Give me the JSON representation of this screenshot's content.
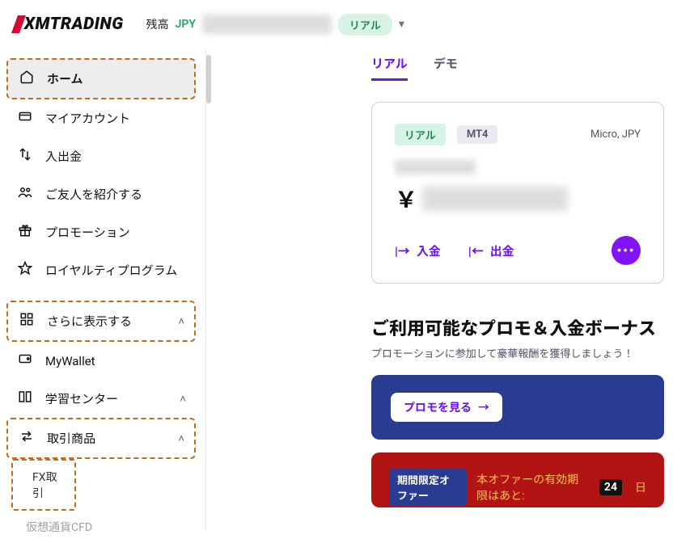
{
  "header": {
    "brand": "XMTRADING",
    "balance_label": "残高",
    "balance_currency": "JPY",
    "account_type": "リアル"
  },
  "sidebar": {
    "items": [
      {
        "icon": "home-icon",
        "glyph": "⌂",
        "label": "ホーム",
        "highlight": true,
        "active": true
      },
      {
        "icon": "account-icon",
        "glyph": "⧉",
        "label": "マイアカウント"
      },
      {
        "icon": "transfer-icon",
        "glyph": "↑↓",
        "label": "入出金"
      },
      {
        "icon": "referral-icon",
        "glyph": "👥",
        "label": "ご友人を紹介する"
      },
      {
        "icon": "gift-icon",
        "glyph": "🎁",
        "label": "プロモーション"
      },
      {
        "icon": "star-icon",
        "glyph": "☆",
        "label": "ロイヤルティプログラム"
      }
    ],
    "more_group": [
      {
        "icon": "grid-icon",
        "glyph": "▦",
        "label": "さらに表示する",
        "chev": true,
        "highlight": true
      },
      {
        "icon": "wallet-icon",
        "glyph": "▭",
        "label": "MyWallet"
      },
      {
        "icon": "book-icon",
        "glyph": "▭▭",
        "label": "学習センター",
        "chev": true
      },
      {
        "icon": "swap-icon",
        "glyph": "⇄",
        "label": "取引商品",
        "chev": true,
        "highlight": true
      }
    ],
    "sub_items": [
      {
        "label": "FX取引",
        "highlight": true
      },
      {
        "label": "仮想通貨CFD"
      }
    ]
  },
  "tabs": {
    "items": [
      {
        "label": "リアル",
        "active": true
      },
      {
        "label": "デモ",
        "active": false
      }
    ]
  },
  "account_card": {
    "pill_type": "リアル",
    "pill_platform": "MT4",
    "meta": "Micro, JPY",
    "currency_glyph": "￥",
    "deposit_label": "入金",
    "withdraw_label": "出金"
  },
  "promo": {
    "title": "ご利用可能なプロモ＆入金ボーナス",
    "subtitle": "プロモーションに参加して豪華報酬を獲得しましょう！",
    "see_button": "プロモを見る"
  },
  "offer": {
    "pill": "期間限定オファー",
    "text_pre": "本オファーの有効期限はあと:",
    "days": "24",
    "text_post": "日"
  }
}
